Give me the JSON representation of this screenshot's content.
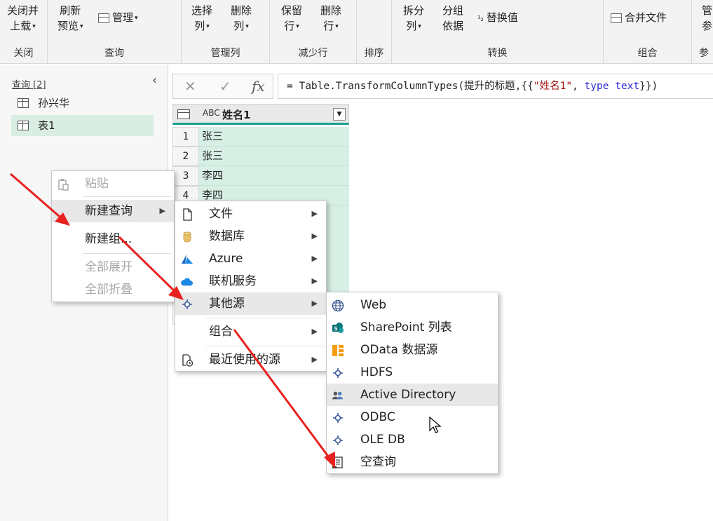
{
  "ribbon": {
    "groups": [
      {
        "label": "关闭",
        "buttons": [
          {
            "line1": "关闭并",
            "line2": "上载",
            "caret": "▾"
          }
        ]
      },
      {
        "label": "查询",
        "buttons": [
          {
            "line1": "刷新",
            "line2": "预览",
            "caret": "▾"
          }
        ],
        "small": [
          {
            "label": "管理",
            "caret": "▾"
          }
        ]
      },
      {
        "label": "管理列",
        "buttons": [
          {
            "line1": "选择",
            "line2": "列",
            "caret": "▾"
          },
          {
            "line1": "删除",
            "line2": "列",
            "caret": "▾"
          }
        ]
      },
      {
        "label": "减少行",
        "buttons": [
          {
            "line1": "保留",
            "line2": "行",
            "caret": "▾"
          },
          {
            "line1": "删除",
            "line2": "行",
            "caret": "▾"
          }
        ]
      },
      {
        "label": "排序"
      },
      {
        "label": "转换",
        "buttons": [
          {
            "line1": "拆分",
            "line2": "列",
            "caret": "▾"
          },
          {
            "line1": "分组",
            "line2": "依据",
            "caret": ""
          }
        ],
        "small": [
          {
            "label": "替换值",
            "caret": ""
          }
        ]
      },
      {
        "label": "组合",
        "small": [
          {
            "label": "合并文件",
            "caret": ""
          }
        ]
      },
      {
        "label": "参",
        "buttons": [
          {
            "line1": "管",
            "line2": "参",
            "caret": ""
          }
        ]
      }
    ]
  },
  "queries": {
    "header": "查询 [2]",
    "collapse": "‹",
    "items": [
      {
        "label": "孙兴华",
        "selected": false
      },
      {
        "label": "表1",
        "selected": true
      }
    ]
  },
  "formula": {
    "cancel": "✕",
    "confirm": "✓",
    "fx": "fx",
    "expr_prefix": "= Table.TransformColumnTypes(提升的标题,{{",
    "expr_string": "\"姓名1\"",
    "expr_mid": ", ",
    "expr_keyword": "type",
    "expr_type": "text",
    "expr_suffix": "}})"
  },
  "grid": {
    "type_icon": "ABC",
    "column": "姓名1",
    "rows": [
      {
        "n": "1",
        "v": "张三"
      },
      {
        "n": "2",
        "v": "张三"
      },
      {
        "n": "3",
        "v": "李四"
      },
      {
        "n": "4",
        "v": "李四"
      }
    ]
  },
  "context_menu": {
    "items": [
      {
        "label": "粘贴",
        "disabled": true
      },
      {
        "label": "新建查询",
        "disabled": false,
        "submenu": true
      },
      {
        "label": "新建组...",
        "disabled": false
      },
      {
        "label": "全部展开",
        "disabled": true
      },
      {
        "label": "全部折叠",
        "disabled": true
      }
    ]
  },
  "new_query_menu": {
    "items": [
      {
        "label": "文件",
        "icon": "file-icon"
      },
      {
        "label": "数据库",
        "icon": "database-icon"
      },
      {
        "label": "Azure",
        "icon": "azure-icon"
      },
      {
        "label": "联机服务",
        "icon": "cloud-icon"
      },
      {
        "label": "其他源",
        "icon": "connector-icon"
      },
      {
        "label": "组合",
        "icon": ""
      },
      {
        "label": "最近使用的源",
        "icon": "recent-sources-icon"
      }
    ]
  },
  "other_sources_menu": {
    "items": [
      {
        "label": "Web",
        "icon": "globe-icon"
      },
      {
        "label": "SharePoint 列表",
        "icon": "sharepoint-icon"
      },
      {
        "label": "OData 数据源",
        "icon": "odata-icon"
      },
      {
        "label": "HDFS",
        "icon": "connector-icon"
      },
      {
        "label": "Active Directory",
        "icon": "users-icon"
      },
      {
        "label": "ODBC",
        "icon": "connector-icon"
      },
      {
        "label": "OLE DB",
        "icon": "connector-icon"
      },
      {
        "label": "空查询",
        "icon": "blank-query-icon"
      }
    ]
  },
  "colors": {
    "accent": "#1aa08c",
    "selected_bg": "#d7efe4",
    "arrow": "#e8211f",
    "azure": "#1565c0"
  }
}
